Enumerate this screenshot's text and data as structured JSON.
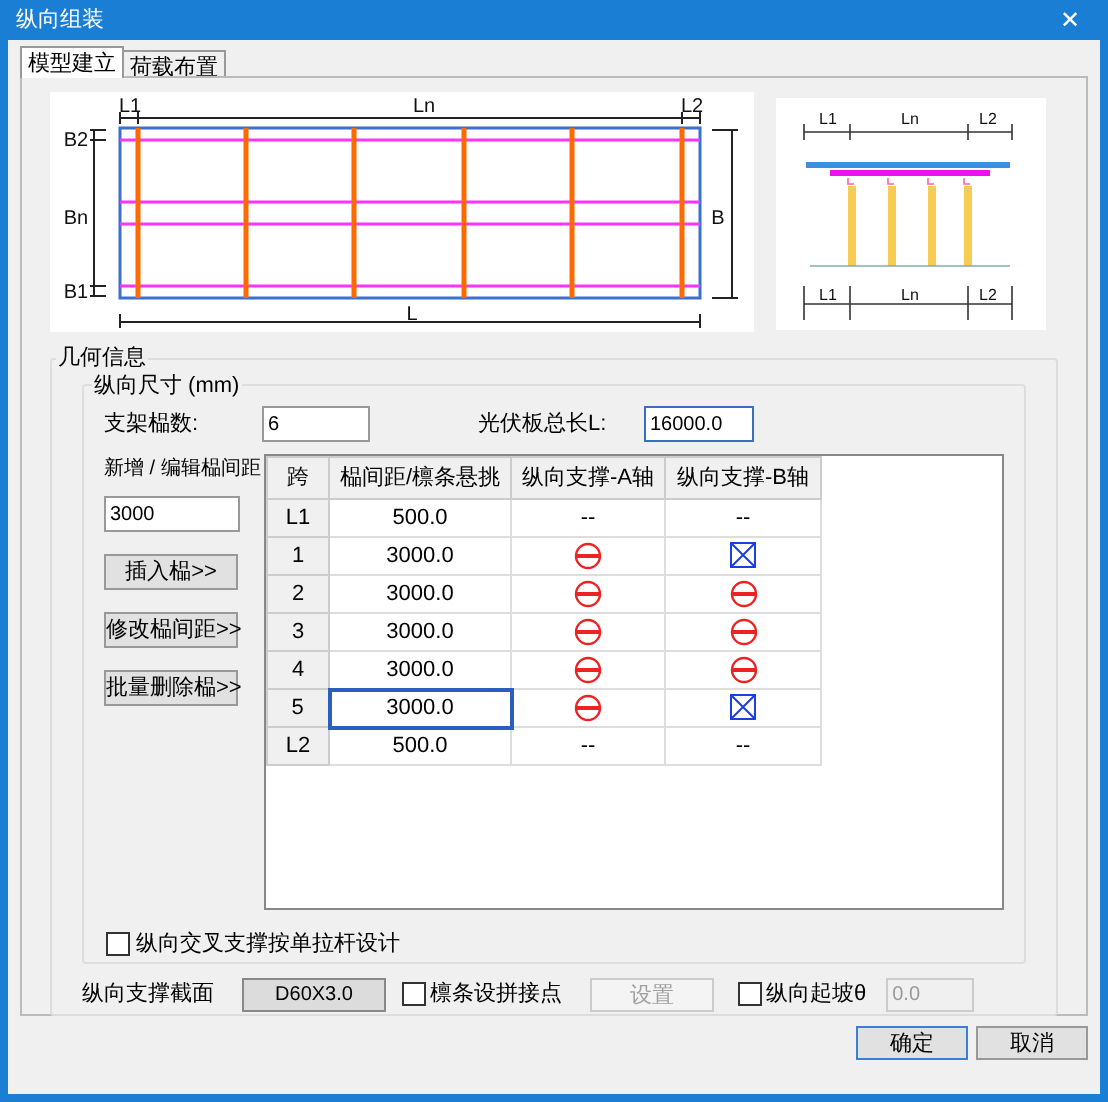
{
  "window": {
    "title": "纵向组装",
    "close": "✕"
  },
  "tabs": [
    {
      "label": "模型建立",
      "selected": true
    },
    {
      "label": "荷载布置",
      "selected": false
    }
  ],
  "plan_diagram": {
    "labels": [
      "L1",
      "Ln",
      "L2",
      "B2",
      "Bn",
      "B1",
      "B",
      "L"
    ]
  },
  "side_diagram": {
    "labels": [
      "L1",
      "Ln",
      "L2",
      "L1",
      "Ln",
      "L2"
    ]
  },
  "geometry": {
    "title": "几何信息",
    "longitudinal": {
      "title": "纵向尺寸 (mm)",
      "frame_count_label": "支架榀数:",
      "frame_count": "6",
      "total_length_label": "光伏板总长L:",
      "total_length": "16000.0",
      "spacing_label": "新增 / 编辑榀间距",
      "spacing_value": "3000",
      "buttons": [
        "插入榀>>",
        "修改榀间距>>",
        "批量删除榀>>"
      ],
      "table": {
        "columns": [
          "跨",
          "榀间距/檩条悬挑",
          "纵向支撑-A轴",
          "纵向支撑-B轴"
        ],
        "rows": [
          {
            "span": "L1",
            "spacing": "500.0",
            "selected": false,
            "a": {
              "kind": "text",
              "text": "--"
            },
            "b": {
              "kind": "text",
              "text": "--"
            }
          },
          {
            "span": "1",
            "spacing": "3000.0",
            "selected": false,
            "a": {
              "kind": "none"
            },
            "b": {
              "kind": "cross"
            }
          },
          {
            "span": "2",
            "spacing": "3000.0",
            "selected": false,
            "a": {
              "kind": "none"
            },
            "b": {
              "kind": "none"
            }
          },
          {
            "span": "3",
            "spacing": "3000.0",
            "selected": false,
            "a": {
              "kind": "none"
            },
            "b": {
              "kind": "none"
            }
          },
          {
            "span": "4",
            "spacing": "3000.0",
            "selected": false,
            "a": {
              "kind": "none"
            },
            "b": {
              "kind": "none"
            }
          },
          {
            "span": "5",
            "spacing": "3000.0",
            "selected": true,
            "a": {
              "kind": "none"
            },
            "b": {
              "kind": "cross"
            }
          },
          {
            "span": "L2",
            "spacing": "500.0",
            "selected": false,
            "a": {
              "kind": "text",
              "text": "--"
            },
            "b": {
              "kind": "text",
              "text": "--"
            }
          }
        ]
      },
      "single_tie_checkbox": {
        "label": "纵向交叉支撑按单拉杆设计",
        "checked": false
      }
    },
    "section_label": "纵向支撑截面",
    "section_button": "D60X3.0",
    "splice_checkbox": {
      "label": "檩条设拼接点",
      "checked": false
    },
    "settings_button": {
      "label": "设置",
      "disabled": true
    },
    "slope_checkbox": {
      "label": "纵向起坡θ",
      "checked": false
    },
    "slope_value": {
      "value": "0.0",
      "disabled": true
    }
  },
  "buttons": [
    "确定",
    "取消"
  ]
}
